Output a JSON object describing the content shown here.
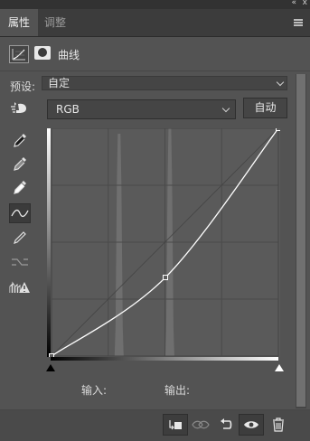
{
  "panel_controls": {
    "collapse_glyph": "«",
    "close_glyph": "x"
  },
  "tabs": [
    {
      "label": "属性",
      "active": true
    },
    {
      "label": "调整",
      "active": false
    }
  ],
  "header": {
    "title": "曲线",
    "adjustment_icon": "curves-adjustment-icon",
    "mask_icon": "layer-mask-icon"
  },
  "preset": {
    "label": "预设:",
    "value": "自定"
  },
  "channel": {
    "value": "RGB",
    "auto_label": "自动"
  },
  "tools": [
    "on-image-adjust-icon",
    "black-point-eyedropper-icon",
    "gray-point-eyedropper-icon",
    "white-point-eyedropper-icon",
    "curve-point-edit-icon",
    "pencil-draw-icon",
    "smooth-curve-icon",
    "clipping-warning-icon"
  ],
  "io": {
    "input_label": "输入:",
    "output_label": "输出:"
  },
  "bottom_icons": [
    "clip-to-layer-icon",
    "view-previous-state-icon",
    "reset-icon",
    "visibility-eye-icon",
    "trash-icon"
  ],
  "curve": {
    "points": [
      [
        0,
        0
      ],
      [
        128,
        88
      ],
      [
        255,
        255
      ]
    ],
    "histogram_peaks": [
      76,
      133
    ]
  },
  "colors": {
    "panel_bg": "#535353",
    "graph_bg": "#5a5a5a",
    "curve": "#ffffff",
    "grid": "#4a4a4a"
  }
}
